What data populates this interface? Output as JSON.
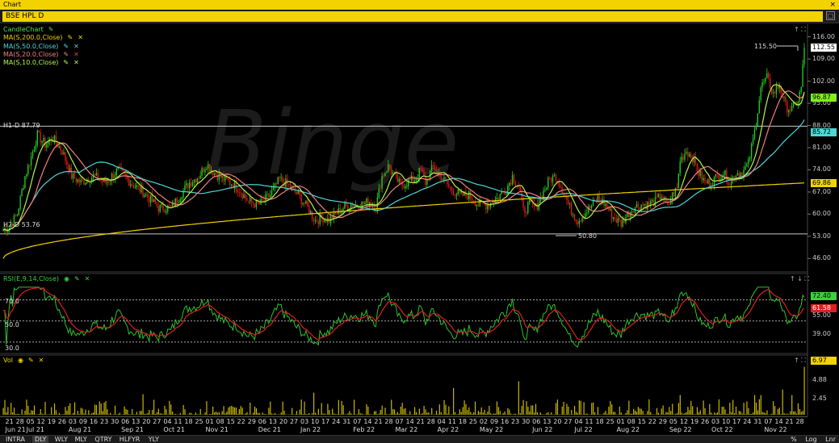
{
  "window": {
    "title": "Chart",
    "close": "×"
  },
  "symbol": "BSE HPL D",
  "price_legend": [
    {
      "label": "CandleChart",
      "color": "#55e055"
    },
    {
      "label": "MA(S,200.0,Close)",
      "color": "#f2d200"
    },
    {
      "label": "MA(S,50.0,Close)",
      "color": "#4fd6d6"
    },
    {
      "label": "MA(S,20.0,Close)",
      "color": "#f08080"
    },
    {
      "label": "MA(S,10.0,Close)",
      "color": "#b6f24a"
    }
  ],
  "hlines": [
    {
      "label": "H1-D 87.79",
      "value": 87.79
    },
    {
      "label": "H2-D 53.76",
      "value": 53.76
    }
  ],
  "price_axis": [
    "116.00",
    "109.00",
    "102.00",
    "95.00",
    "88.00",
    "81.00",
    "74.00",
    "67.00",
    "60.00",
    "53.00",
    "46.00"
  ],
  "price_badges": [
    {
      "text": "112.55",
      "value": 112.55,
      "bg": "#ffffff"
    },
    {
      "text": "96.87",
      "value": 96.87,
      "bg": "#7ff21a"
    },
    {
      "text": "85.72",
      "value": 85.72,
      "bg": "#4fd6d6"
    },
    {
      "text": "69.86",
      "value": 69.86,
      "bg": "#f2d200"
    }
  ],
  "annotations": {
    "high": "115.50",
    "low": "50.80"
  },
  "watermark": "Binge",
  "rsi": {
    "label": "RSI(E,9,14,Close)",
    "levels": [
      "70.0",
      "50.0",
      "30.0"
    ],
    "axis": [
      "55.00",
      "39.00"
    ],
    "badges": [
      {
        "text": "72.40",
        "value": 72.4,
        "bg": "#3bd13b"
      },
      {
        "text": "61.58",
        "value": 61.58,
        "bg": "#e02020"
      }
    ]
  },
  "volume": {
    "label": "Vol",
    "axis": [
      "4.88",
      "2.45"
    ],
    "badge": {
      "text": "6.97",
      "value": 6.97,
      "bg": "#f2d200"
    }
  },
  "x_labels": [
    [
      "21",
      "Jun 21"
    ],
    [
      "28",
      ""
    ],
    [
      "05",
      "Jul 21"
    ],
    [
      "12",
      ""
    ],
    [
      "19",
      ""
    ],
    [
      "26",
      ""
    ],
    [
      "03",
      "Aug 21"
    ],
    [
      "09",
      ""
    ],
    [
      "16",
      ""
    ],
    [
      "23",
      ""
    ],
    [
      "30",
      ""
    ],
    [
      "06",
      "Sep 21"
    ],
    [
      "13",
      ""
    ],
    [
      "20",
      ""
    ],
    [
      "27",
      ""
    ],
    [
      "04",
      "Oct 21"
    ],
    [
      "11",
      ""
    ],
    [
      "18",
      ""
    ],
    [
      "25",
      ""
    ],
    [
      "01",
      "Nov 21"
    ],
    [
      "08",
      ""
    ],
    [
      "15",
      ""
    ],
    [
      "22",
      ""
    ],
    [
      "29",
      ""
    ],
    [
      "06",
      "Dec 21"
    ],
    [
      "13",
      ""
    ],
    [
      "20",
      ""
    ],
    [
      "27",
      ""
    ],
    [
      "03",
      "Jan 22"
    ],
    [
      "10",
      ""
    ],
    [
      "17",
      ""
    ],
    [
      "24",
      ""
    ],
    [
      "31",
      ""
    ],
    [
      "07",
      "Feb 22"
    ],
    [
      "14",
      ""
    ],
    [
      "21",
      ""
    ],
    [
      "28",
      ""
    ],
    [
      "07",
      "Mar 22"
    ],
    [
      "14",
      ""
    ],
    [
      "21",
      ""
    ],
    [
      "28",
      ""
    ],
    [
      "04",
      "Apr 22"
    ],
    [
      "11",
      ""
    ],
    [
      "18",
      ""
    ],
    [
      "25",
      ""
    ],
    [
      "02",
      "May 22"
    ],
    [
      "09",
      ""
    ],
    [
      "16",
      ""
    ],
    [
      "23",
      ""
    ],
    [
      "30",
      ""
    ],
    [
      "06",
      "Jun 22"
    ],
    [
      "13",
      ""
    ],
    [
      "20",
      ""
    ],
    [
      "27",
      ""
    ],
    [
      "04",
      "Jul 22"
    ],
    [
      "11",
      ""
    ],
    [
      "18",
      ""
    ],
    [
      "25",
      ""
    ],
    [
      "01",
      "Aug 22"
    ],
    [
      "08",
      ""
    ],
    [
      "15",
      ""
    ],
    [
      "22",
      ""
    ],
    [
      "29",
      ""
    ],
    [
      "05",
      "Sep 22"
    ],
    [
      "12",
      ""
    ],
    [
      "19",
      ""
    ],
    [
      "26",
      ""
    ],
    [
      "03",
      "Oct 22"
    ],
    [
      "10",
      ""
    ],
    [
      "17",
      ""
    ],
    [
      "24",
      ""
    ],
    [
      "31",
      ""
    ],
    [
      "07",
      "Nov 22"
    ],
    [
      "14",
      ""
    ],
    [
      "21",
      ""
    ],
    [
      "28",
      ""
    ]
  ],
  "timeframes": [
    "INTRA",
    "DLY",
    "WLY",
    "MLY",
    "QTRY",
    "HLFYR",
    "YLY"
  ],
  "active_timeframe": "DLY",
  "bottom_right": [
    "%",
    "Log",
    "Lnr"
  ],
  "chart_data": {
    "type": "candlestick",
    "price_range": [
      42,
      120
    ],
    "close_series_keypoints": [
      [
        0,
        55
      ],
      [
        4,
        56
      ],
      [
        9,
        60
      ],
      [
        14,
        72
      ],
      [
        18,
        78
      ],
      [
        22,
        85
      ],
      [
        27,
        82
      ],
      [
        32,
        84
      ],
      [
        38,
        80
      ],
      [
        44,
        72
      ],
      [
        50,
        70
      ],
      [
        58,
        72
      ],
      [
        66,
        70
      ],
      [
        74,
        74
      ],
      [
        82,
        70
      ],
      [
        90,
        67
      ],
      [
        100,
        62
      ],
      [
        108,
        62
      ],
      [
        114,
        66
      ],
      [
        120,
        70
      ],
      [
        126,
        72
      ],
      [
        131,
        76
      ],
      [
        136,
        73
      ],
      [
        142,
        71
      ],
      [
        150,
        69
      ],
      [
        158,
        64
      ],
      [
        165,
        63
      ],
      [
        172,
        66
      ],
      [
        178,
        71
      ],
      [
        184,
        69
      ],
      [
        190,
        66
      ],
      [
        196,
        62
      ],
      [
        201,
        58
      ],
      [
        206,
        59
      ],
      [
        210,
        58
      ],
      [
        214,
        60
      ],
      [
        219,
        62
      ],
      [
        224,
        63
      ],
      [
        230,
        63
      ],
      [
        236,
        64
      ],
      [
        240,
        62
      ],
      [
        244,
        72
      ],
      [
        248,
        75
      ],
      [
        252,
        72
      ],
      [
        256,
        69
      ],
      [
        260,
        70
      ],
      [
        265,
        71
      ],
      [
        269,
        74
      ],
      [
        272,
        70
      ],
      [
        277,
        75
      ],
      [
        282,
        72
      ],
      [
        288,
        68
      ],
      [
        294,
        66
      ],
      [
        300,
        66
      ],
      [
        306,
        63
      ],
      [
        312,
        63
      ],
      [
        318,
        65
      ],
      [
        324,
        68
      ],
      [
        328,
        72
      ],
      [
        332,
        69
      ],
      [
        335,
        61
      ],
      [
        339,
        63
      ],
      [
        343,
        62
      ],
      [
        347,
        66
      ],
      [
        352,
        71
      ],
      [
        356,
        72
      ],
      [
        360,
        68
      ],
      [
        365,
        62
      ],
      [
        370,
        58
      ],
      [
        374,
        60
      ],
      [
        378,
        62
      ],
      [
        383,
        65
      ],
      [
        388,
        63
      ],
      [
        393,
        59
      ],
      [
        398,
        57
      ],
      [
        402,
        60
      ],
      [
        406,
        62
      ],
      [
        410,
        63
      ],
      [
        415,
        63
      ],
      [
        420,
        64
      ],
      [
        424,
        66
      ],
      [
        428,
        62
      ],
      [
        431,
        66
      ],
      [
        434,
        68
      ],
      [
        436,
        77
      ],
      [
        440,
        80
      ],
      [
        444,
        78
      ],
      [
        448,
        73
      ],
      [
        452,
        70
      ],
      [
        456,
        70
      ],
      [
        460,
        72
      ],
      [
        464,
        73
      ],
      [
        468,
        70
      ],
      [
        472,
        73
      ],
      [
        476,
        73
      ],
      [
        480,
        76
      ],
      [
        484,
        86
      ],
      [
        488,
        100
      ],
      [
        492,
        103
      ],
      [
        496,
        98
      ],
      [
        500,
        101
      ],
      [
        504,
        94
      ],
      [
        508,
        93
      ],
      [
        512,
        96
      ],
      [
        514,
        100
      ],
      [
        516,
        112.55
      ]
    ],
    "sessions": 517,
    "high_label": 115.5,
    "low_label": 50.8,
    "rsi_range": [
      20,
      85
    ],
    "volume_max": 7.5
  }
}
